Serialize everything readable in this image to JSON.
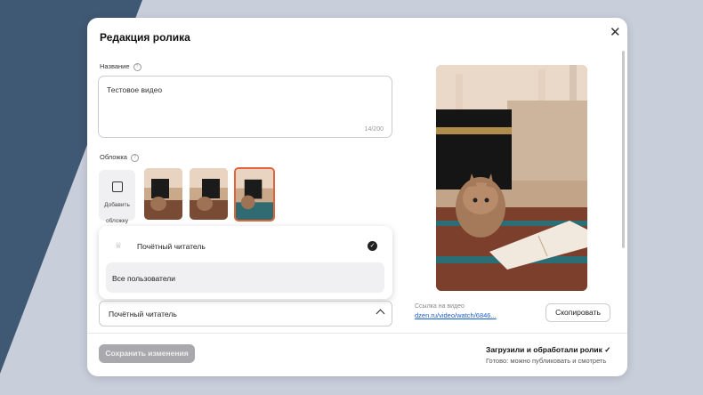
{
  "modal": {
    "title": "Редакция ролика",
    "close": "✕"
  },
  "name_field": {
    "label": "Название",
    "value": "Тестовое видео",
    "counter": "14/200"
  },
  "cover": {
    "label": "Обложка",
    "add_label": "Добавить обложку"
  },
  "visibility": {
    "options": [
      {
        "label": "Почётный читатель",
        "selected": true
      },
      {
        "label": "Все пользователи",
        "selected": false
      }
    ],
    "current": "Почётный читатель"
  },
  "link": {
    "label": "Ссылка на видео",
    "url": "dzen.ru/video/watch/6846..."
  },
  "buttons": {
    "copy": "Скопировать",
    "save": "Сохранить изменения"
  },
  "status": {
    "title": "Загрузили и обработали ролик ✓",
    "subtitle": "Готово: можно публиковать и смотреть"
  },
  "colors": {
    "accent": "#e2623c",
    "link": "#1a5fd0"
  }
}
